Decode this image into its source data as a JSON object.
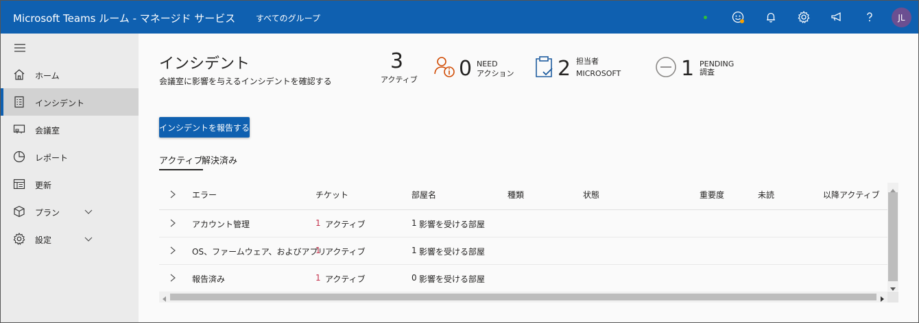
{
  "header": {
    "app_title": "Microsoft Teams ルーム - マネージド サービス",
    "group_selector": "すべてのグループ",
    "avatar_initials": "JL",
    "accent_color": "#0f60b0"
  },
  "sidebar": {
    "items": [
      {
        "label": "ホーム",
        "icon": "home-icon"
      },
      {
        "label": "インシデント",
        "icon": "incident-icon"
      },
      {
        "label": "会議室",
        "icon": "room-icon"
      },
      {
        "label": "レポート",
        "icon": "report-icon"
      },
      {
        "label": "更新",
        "icon": "updates-icon"
      },
      {
        "label": "プラン",
        "icon": "plan-icon"
      },
      {
        "label": "設定",
        "icon": "settings-icon"
      }
    ]
  },
  "page": {
    "title": "インシデント",
    "subtitle": "会議室に影響を与えるインシデントを確認する"
  },
  "stats": {
    "active": {
      "value": "3",
      "label": "アクティブ"
    },
    "need_action": {
      "value": "0",
      "label_line1": "NEED",
      "label_line2": "アクション"
    },
    "assigned": {
      "value": "2",
      "label_line1": "担当者",
      "label_line2": "MICROSOFT"
    },
    "pending": {
      "value": "1",
      "label_line1": "PENDING",
      "label_line2": "調査"
    }
  },
  "actions": {
    "report_button": "インシデントを報告する"
  },
  "tabs": [
    {
      "label": "アクティブ",
      "active": true
    },
    {
      "label": "解決済み",
      "active": false
    }
  ],
  "table": {
    "columns": [
      "エラー",
      "チケット",
      "部屋名",
      "種類",
      "状態",
      "重要度",
      "未読",
      "以降アクティブ"
    ],
    "rows": [
      {
        "error": "アカウント管理",
        "ticket_count": "1",
        "ticket_text": "アクティブ",
        "room_count": "1",
        "room_text": "影響を受ける部屋"
      },
      {
        "error": "OS、ファームウェア、およびアプリ",
        "ticket_count": "1",
        "ticket_text": "アクティブ",
        "room_count": "1",
        "room_text": "影響を受ける部屋"
      },
      {
        "error": "報告済み",
        "ticket_count": "1",
        "ticket_text": "アクティブ",
        "room_count": "0",
        "room_text": "影響を受ける部屋"
      }
    ]
  }
}
